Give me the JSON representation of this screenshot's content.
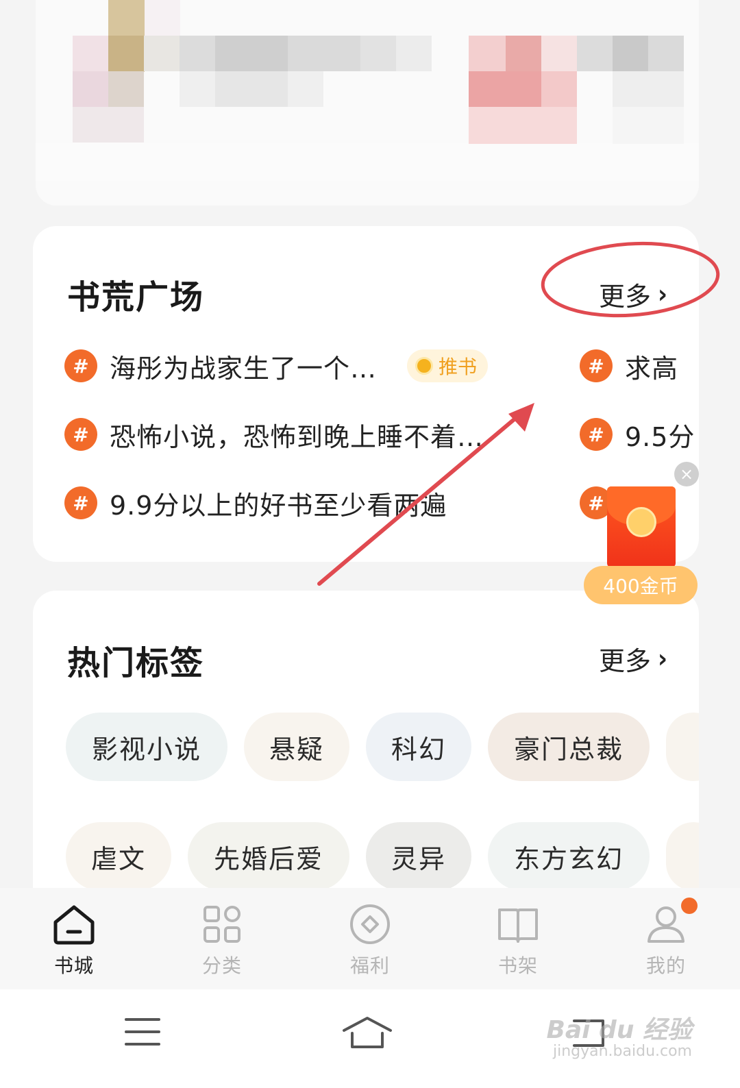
{
  "square": {
    "title": "书荒广场",
    "more_label": "更多",
    "topics_left": [
      "海彤为战家生了一个…",
      "恐怖小说，恐怖到晚上睡不着…",
      "9.9分以上的好书至少看两遍"
    ],
    "promo_tag": "推书",
    "topics_right": [
      "求高",
      "9.5分",
      ""
    ]
  },
  "tags": {
    "title": "热门标签",
    "more_label": "更多",
    "row1": [
      "影视小说",
      "悬疑",
      "科幻",
      "豪门总裁"
    ],
    "row2": [
      "虐文",
      "先婚后爱",
      "灵异",
      "东方玄幻"
    ]
  },
  "reward": {
    "close_symbol": "×",
    "badge": "400金币"
  },
  "hash_symbol": "#",
  "nav": {
    "items": [
      {
        "label": "书城",
        "icon": "home-icon"
      },
      {
        "label": "分类",
        "icon": "grid-icon"
      },
      {
        "label": "福利",
        "icon": "diamond-circle-icon"
      },
      {
        "label": "书架",
        "icon": "open-book-icon"
      },
      {
        "label": "我的",
        "icon": "user-icon"
      }
    ],
    "active_index": 0
  },
  "watermark": {
    "brand": "Bai du 经验",
    "url": "jingyan.baidu.com"
  },
  "colors": {
    "accent": "#f26b2a",
    "annotation": "#e04a50",
    "badge": "#ffc46e"
  }
}
